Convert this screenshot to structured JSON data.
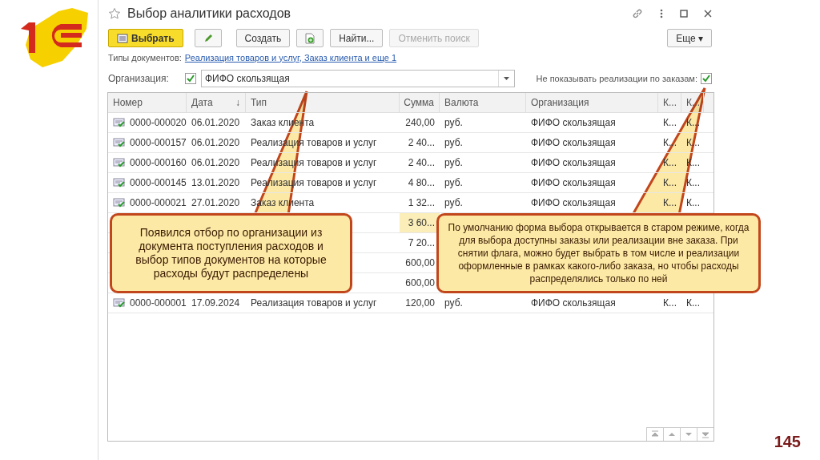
{
  "window": {
    "title": "Выбор аналитики расходов"
  },
  "toolbar": [
    {
      "kind": "primary",
      "label": "Выбрать",
      "disabled": false
    },
    {
      "kind": "edit-icon",
      "disabled": false
    },
    {
      "kind": "text",
      "label": "Создать",
      "disabled": false
    },
    {
      "kind": "copy-icon",
      "disabled": false
    },
    {
      "kind": "text",
      "label": "Найти...",
      "disabled": false
    },
    {
      "kind": "text",
      "label": "Отменить поиск",
      "disabled": true
    },
    {
      "kind": "more",
      "label": "Еще",
      "caret": "▾",
      "disabled": false
    }
  ],
  "doc_types": {
    "label": "Типы документов:",
    "link": "Реализация товаров и услуг, Заказ клиента и еще 1"
  },
  "organization": {
    "label": "Организация:",
    "checked": true,
    "value": "ФИФО скользящая"
  },
  "hide_orders": {
    "label": "Не показывать реализации по заказам:",
    "checked": true
  },
  "table": {
    "columns": [
      {
        "label": "Номер"
      },
      {
        "label": "Дата",
        "sort": "↓"
      },
      {
        "label": "Тип"
      },
      {
        "label": "Сумма"
      },
      {
        "label": "Валюта"
      },
      {
        "label": "Организация"
      },
      {
        "label": "К..."
      },
      {
        "label": "К..."
      }
    ],
    "rows": [
      {
        "kind": "full",
        "selected": false,
        "cells": [
          "0000-000020",
          "06.01.2020",
          "Заказ клиента",
          "240,00",
          "руб.",
          "ФИФО скользящая",
          "К...",
          "К..."
        ]
      },
      {
        "kind": "full",
        "selected": false,
        "cells": [
          "0000-000157",
          "06.01.2020",
          "Реализация товаров и услуг",
          "2 40...",
          "руб.",
          "ФИФО скользящая",
          "К...",
          "К..."
        ]
      },
      {
        "kind": "full",
        "selected": false,
        "cells": [
          "0000-000160",
          "06.01.2020",
          "Реализация товаров и услуг",
          "2 40...",
          "руб.",
          "ФИФО скользящая",
          "К...",
          "К..."
        ]
      },
      {
        "kind": "full",
        "selected": false,
        "cells": [
          "0000-000145",
          "13.01.2020",
          "Реализация товаров и услуг",
          "4 80...",
          "руб.",
          "ФИФО скользящая",
          "К...",
          "К..."
        ]
      },
      {
        "kind": "full",
        "selected": false,
        "cells": [
          "0000-000021",
          "27.01.2020",
          "Заказ клиента",
          "1 32...",
          "руб.",
          "ФИФО скользящая",
          "К...",
          "К..."
        ]
      },
      {
        "kind": "covered",
        "selected": true,
        "sum": "3 60..."
      },
      {
        "kind": "covered",
        "selected": false,
        "sum": "7 20..."
      },
      {
        "kind": "covered",
        "selected": false,
        "sum": "600,00"
      },
      {
        "kind": "covered",
        "selected": false,
        "sum": "600,00"
      },
      {
        "kind": "full",
        "selected": false,
        "cells": [
          "0000-000001",
          "17.09.2024",
          "Реализация товаров и услуг",
          "120,00",
          "руб.",
          "ФИФО скользящая",
          "К...",
          "К..."
        ]
      }
    ]
  },
  "callouts": [
    {
      "text": "Появился отбор по организации из документа поступления расходов и выбор типов документов на которые расходы будут распределены"
    },
    {
      "text": "По умолчанию форма выбора открывается в старом режиме, когда для выбора доступны заказы или реализации вне заказа. При снятии флага, можно будет выбрать в том числе и реализации оформленные в рамках какого-либо заказа, но чтобы расходы распределялись только по ней"
    }
  ],
  "page_number": "145"
}
